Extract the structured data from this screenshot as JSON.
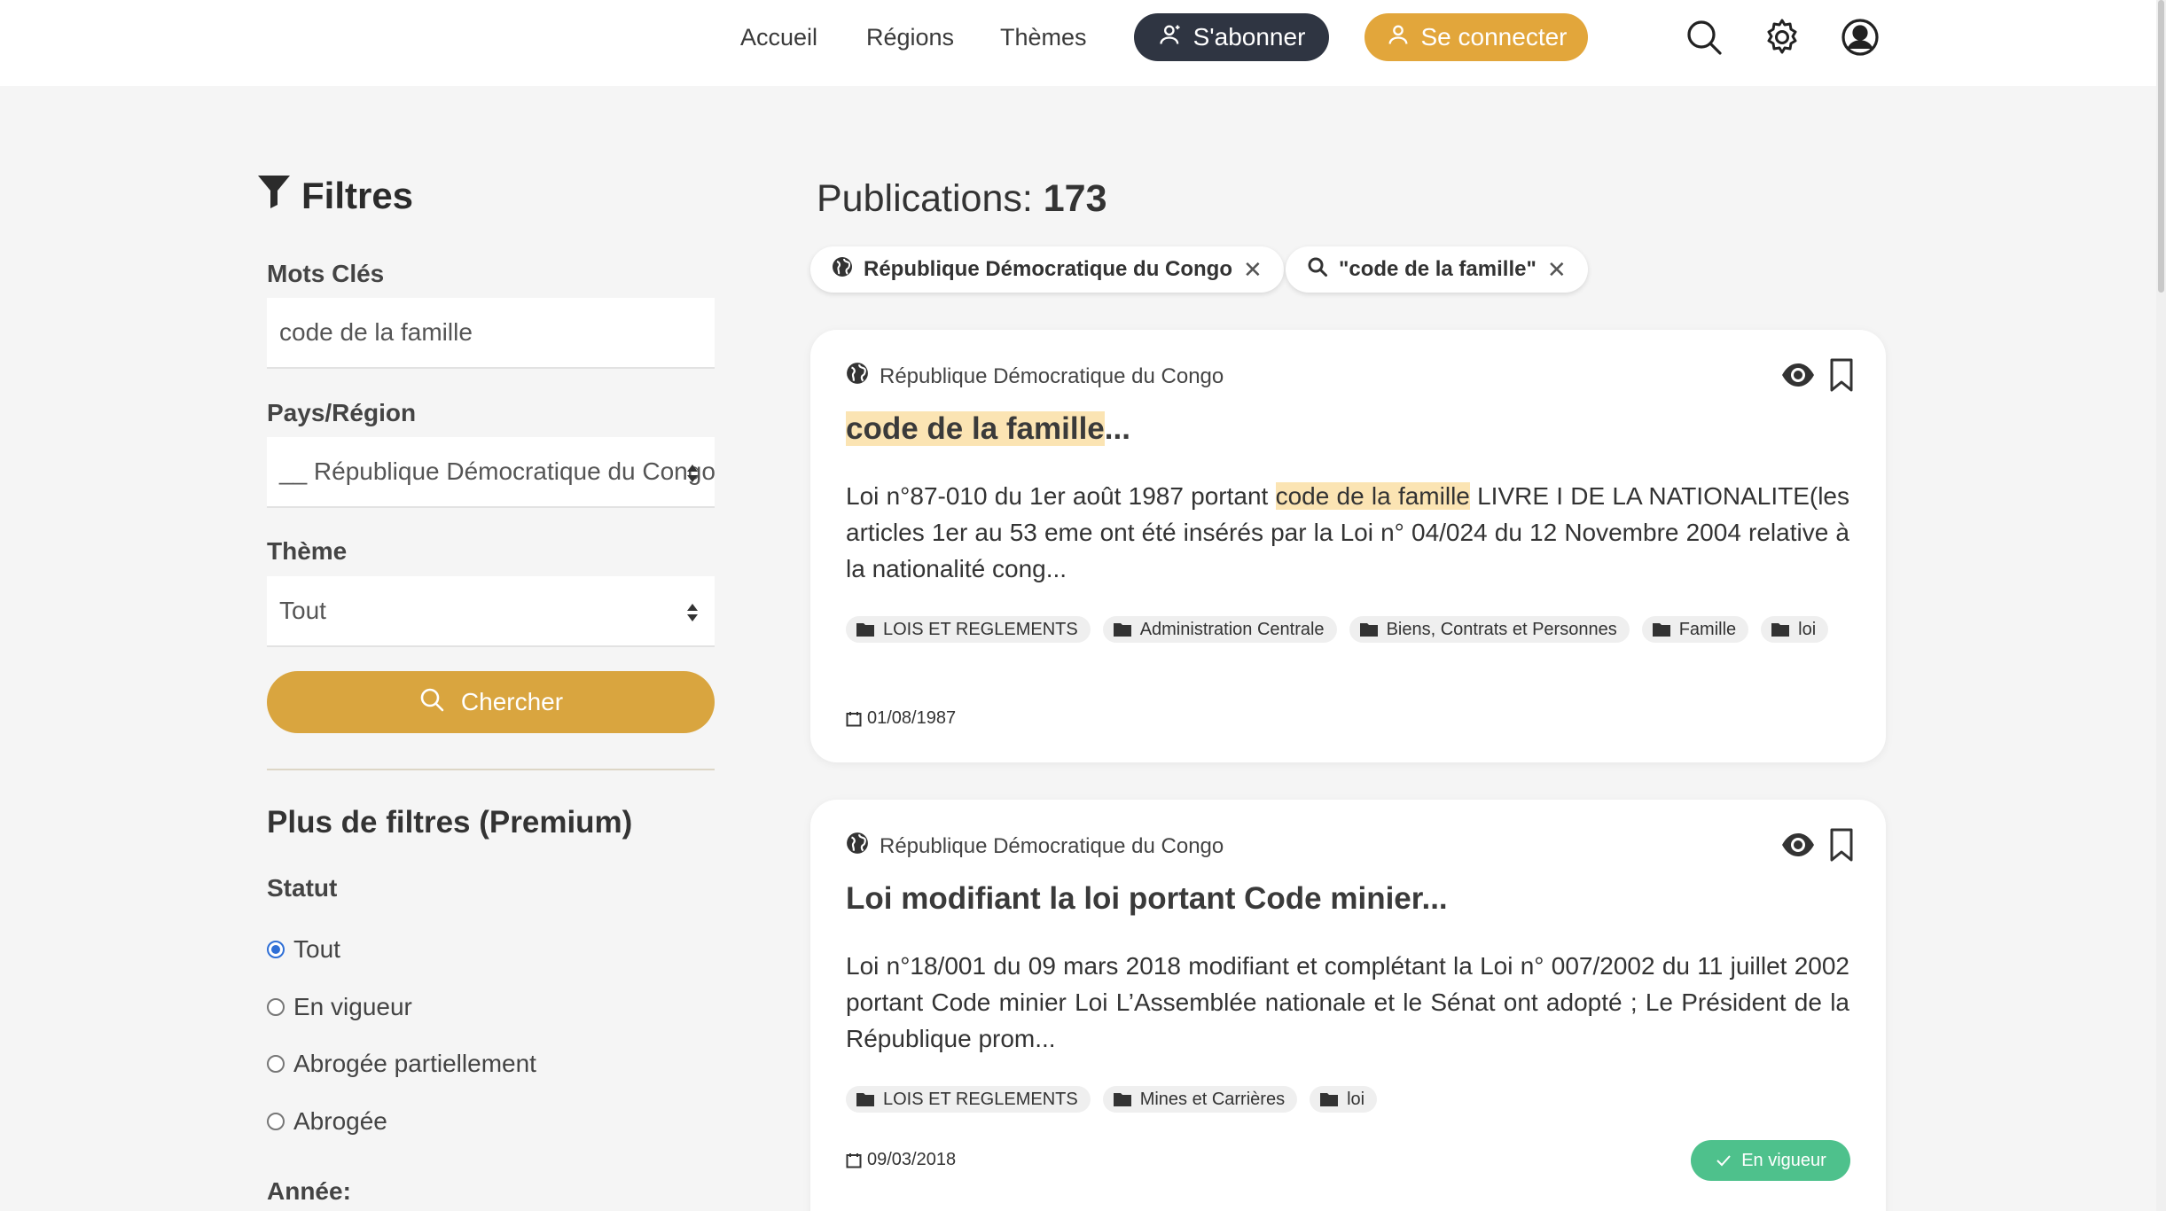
{
  "header": {
    "nav": [
      "Accueil",
      "Régions",
      "Thèmes"
    ],
    "subscribe_label": "S'abonner",
    "login_label": "Se connecter",
    "icons": [
      "search-icon",
      "settings-gear-icon",
      "user-account-icon"
    ]
  },
  "sidebar": {
    "title": "Filtres",
    "keywords_label": "Mots Clés",
    "keywords_value": "code de la famille",
    "country_label": "Pays/Région",
    "country_value": "__ République Démocratique du Congo",
    "theme_label": "Thème",
    "theme_value": "Tout",
    "search_label": "Chercher",
    "premium_title": "Plus de filtres (Premium)",
    "status_label": "Statut",
    "status_options": [
      "Tout",
      "En vigueur",
      "Abrogée partiellement",
      "Abrogée"
    ],
    "status_selected": "Tout",
    "year_label": "Année:"
  },
  "main": {
    "publications_label": "Publications:",
    "publications_count": "173",
    "chips": [
      {
        "label": "République Démocratique du Congo",
        "icon": "globe-icon"
      },
      {
        "label": "\"code de la famille\"",
        "icon": "search-icon"
      }
    ],
    "results": [
      {
        "country": "République Démocratique du Congo",
        "title_highlight": "code de la famille",
        "title_rest": "...",
        "body_before": "Loi n°87-010 du 1er août 1987 portant ",
        "body_highlight": "code de la famille",
        "body_after": " LIVRE I DE LA NATIONALITE(les articles 1er au 53 eme ont été insérés par la Loi n° 04/024 du 12 Novembre 2004 relative à la nationalité cong...",
        "tags": [
          "LOIS ET REGLEMENTS",
          "Administration Centrale",
          "Biens, Contrats et Personnes",
          "Famille",
          "loi"
        ],
        "date": "01/08/1987"
      },
      {
        "country": "République Démocratique du Congo",
        "title": "Loi modifiant la loi portant Code minier...",
        "body": "Loi n°18/001 du 09 mars 2018 modifiant et complétant la Loi n° 007/2002 du 11 juillet 2002 portant Code minier Loi L’Assemblée nationale et le Sénat ont adopté ; Le Président de la République prom...",
        "tags": [
          "LOIS ET REGLEMENTS",
          "Mines et Carrières",
          "loi"
        ],
        "date": "09/03/2018",
        "status": "En vigueur"
      }
    ]
  },
  "colors": {
    "gold": "#e2a63b",
    "dark_button": "#2f3542",
    "status_green": "#4ec18c",
    "highlight": "#fbe4b3"
  }
}
